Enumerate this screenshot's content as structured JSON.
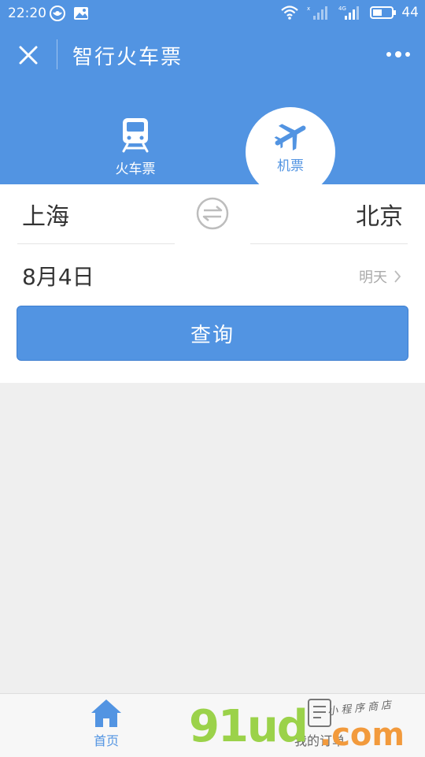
{
  "status_bar": {
    "time": "22:20",
    "network": "4G",
    "battery": "44"
  },
  "title_bar": {
    "title": "智行火车票"
  },
  "mode_tabs": [
    {
      "label": "火车票",
      "icon": "train-icon",
      "active": false
    },
    {
      "label": "机票",
      "icon": "airplane-icon",
      "active": true
    }
  ],
  "form": {
    "from_city": "上海",
    "to_city": "北京",
    "date": "8月4日",
    "date_hint": "明天",
    "search_label": "查询"
  },
  "tab_bar": {
    "items": [
      {
        "label": "首页",
        "icon": "home-icon",
        "active": true
      },
      {
        "label": "我的订单",
        "icon": "orders-icon",
        "active": false
      }
    ]
  },
  "watermark": {
    "main": "91ud",
    "dotcom": ".com",
    "tagline": "小程序商店"
  },
  "colors": {
    "brand_blue": "#5294e2",
    "background": "#efefef",
    "watermark_green": "#9bd24a",
    "watermark_orange": "#f29a3c"
  }
}
